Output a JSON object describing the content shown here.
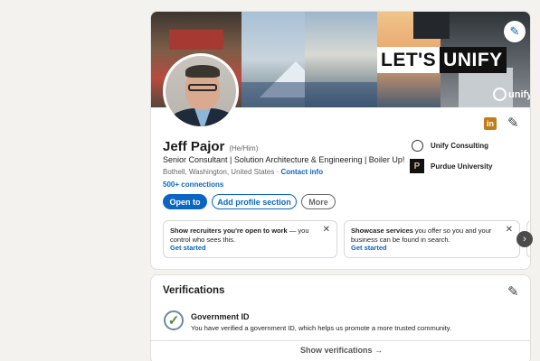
{
  "banner": {
    "headline_part1": "LET'S",
    "headline_part2": "UNIFY",
    "brand": "unify",
    "edit_icon": "pencil-icon"
  },
  "profile": {
    "name": "Jeff Pajor",
    "pronouns": "(He/Him)",
    "headline": "Senior Consultant | Solution Architecture & Engineering | Boiler Up!",
    "location": "Bothell, Washington, United States · ",
    "contact_info": "Contact info",
    "connections": "500+ connections",
    "linkedin_badge": "in",
    "edit_icon": "pencil-icon"
  },
  "organizations": [
    {
      "name": "Unify Consulting",
      "logo": "unify-logo-icon"
    },
    {
      "name": "Purdue University",
      "logo": "purdue-logo-icon",
      "logo_text": "P"
    }
  ],
  "actions": {
    "open_to": "Open to",
    "add_section": "Add profile section",
    "more": "More"
  },
  "promos": [
    {
      "bold": "Show recruiters you're open to work",
      "rest": " — you control who sees this.",
      "cta": "Get started",
      "close": "✕"
    },
    {
      "bold": "Showcase services",
      "rest": " you offer so you and your business can be found in search.",
      "cta": "Get started",
      "close": "✕"
    }
  ],
  "carousel": {
    "next": "›"
  },
  "verifications": {
    "title": "Verifications",
    "item_title": "Government ID",
    "item_desc": "You have verified a government ID, which helps us promote a more trusted community.",
    "show_link": "Show verifications →",
    "check_icon": "verified-check-icon"
  },
  "colors": {
    "accent": "#0a66c2",
    "page_bg": "#f3f2ef",
    "linkedin_badge": "#c37d16"
  }
}
